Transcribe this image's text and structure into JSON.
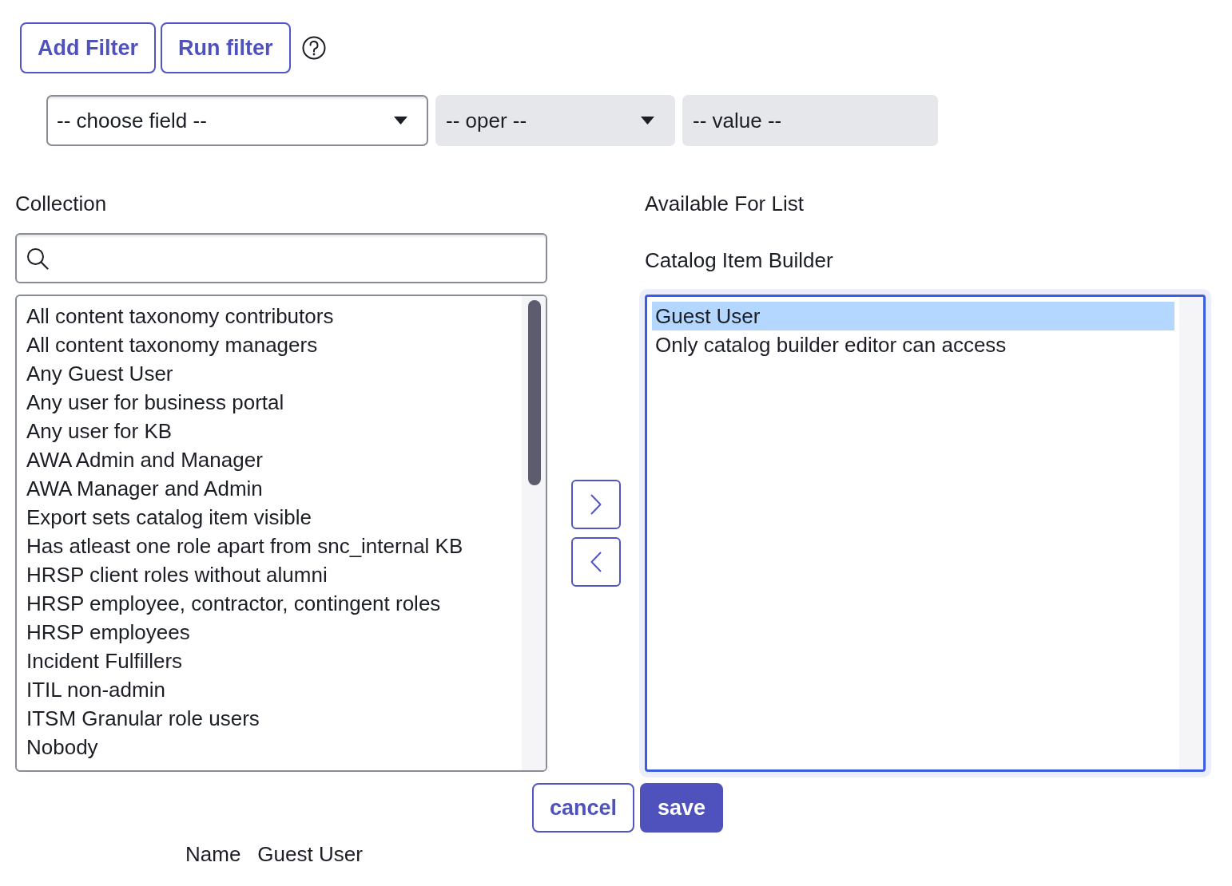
{
  "toolbar": {
    "buttons": [
      {
        "label": "Add Filter",
        "kind": "outline"
      },
      {
        "label": "Run filter",
        "kind": "outline"
      }
    ]
  },
  "filter": {
    "field": {
      "value": "-- choose field --",
      "disabled": false
    },
    "operator": {
      "value": "-- oper --",
      "disabled": true
    },
    "value": {
      "value": "-- value --",
      "disabled": true
    }
  },
  "collection": {
    "label": "Collection",
    "items": [
      {
        "label": "All content taxonomy contributors",
        "selected": false
      },
      {
        "label": "All content taxonomy managers",
        "selected": false
      },
      {
        "label": "Any Guest User",
        "selected": false
      },
      {
        "label": "Any user for business portal",
        "selected": false
      },
      {
        "label": "Any user for KB",
        "selected": false
      },
      {
        "label": "AWA Admin and Manager",
        "selected": false
      },
      {
        "label": "AWA Manager and Admin",
        "selected": false
      },
      {
        "label": "Export sets catalog item visible",
        "selected": false
      },
      {
        "label": "Has atleast one role apart from snc_internal KB",
        "selected": false
      },
      {
        "label": "HRSP client roles without alumni",
        "selected": false
      },
      {
        "label": "HRSP employee, contractor, contingent roles",
        "selected": false
      },
      {
        "label": "HRSP employees",
        "selected": false
      },
      {
        "label": "Incident Fulfillers",
        "selected": false
      },
      {
        "label": "ITIL non-admin",
        "selected": false
      },
      {
        "label": "ITSM Granular role users",
        "selected": false
      },
      {
        "label": "Nobody",
        "selected": false
      }
    ]
  },
  "available": {
    "label": "Available For List",
    "title": "Catalog Item Builder",
    "focused": true,
    "items": [
      {
        "label": "Guest User",
        "selected": true
      },
      {
        "label": "Only catalog builder editor can access",
        "selected": false
      }
    ]
  },
  "actions": [
    {
      "label": "cancel",
      "kind": "outline"
    },
    {
      "label": "save",
      "kind": "primary"
    }
  ],
  "details": [
    {
      "label": "Name",
      "value": "Guest User"
    }
  ]
}
